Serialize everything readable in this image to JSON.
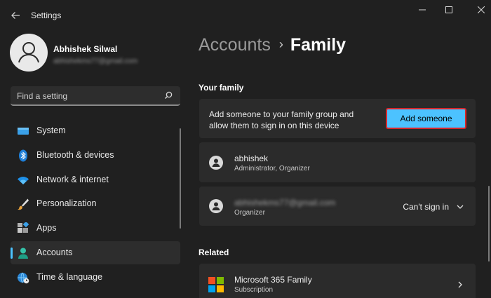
{
  "window": {
    "title": "Settings",
    "icons": {
      "back": "back-arrow-icon",
      "minimize": "minimize-icon",
      "maximize": "maximize-icon",
      "close": "close-icon"
    }
  },
  "profile": {
    "name": "Abhishek Silwal",
    "email": "abhishekms77@gmail.com",
    "avatar": "person-avatar-icon"
  },
  "search": {
    "placeholder": "Find a setting",
    "icon": "search-icon"
  },
  "sidebar": {
    "accent_color": "#4cc2ff",
    "items": [
      {
        "label": "System",
        "icon": "system-display-icon",
        "selected": false
      },
      {
        "label": "Bluetooth & devices",
        "icon": "bluetooth-icon",
        "selected": false
      },
      {
        "label": "Network & internet",
        "icon": "wifi-icon",
        "selected": false
      },
      {
        "label": "Personalization",
        "icon": "paintbrush-icon",
        "selected": false
      },
      {
        "label": "Apps",
        "icon": "apps-grid-icon",
        "selected": false
      },
      {
        "label": "Accounts",
        "icon": "accounts-person-icon",
        "selected": true
      },
      {
        "label": "Time & language",
        "icon": "globe-clock-icon",
        "selected": false
      }
    ]
  },
  "breadcrumb": {
    "parent": "Accounts",
    "separator": "›",
    "current": "Family"
  },
  "your_family": {
    "title": "Your family",
    "add_card": {
      "line1": "Add someone to your family group and",
      "line2": "allow them to sign in on this device",
      "button_label": "Add someone",
      "button_color": "#4cc2ff",
      "highlight_color": "#d8262b"
    },
    "members": [
      {
        "name": "abhishek",
        "role": "Administrator, Organizer",
        "icon": "person-icon"
      },
      {
        "name": "abhishekms77@gmail.com",
        "role": "Organizer",
        "status": "Can't sign in",
        "icon": "person-icon",
        "expand_icon": "chevron-down-icon"
      }
    ]
  },
  "related": {
    "title": "Related",
    "items": [
      {
        "title": "Microsoft 365 Family",
        "subtitle": "Subscription",
        "icon": "microsoft-logo-icon",
        "arrow_icon": "chevron-right-icon"
      }
    ]
  }
}
